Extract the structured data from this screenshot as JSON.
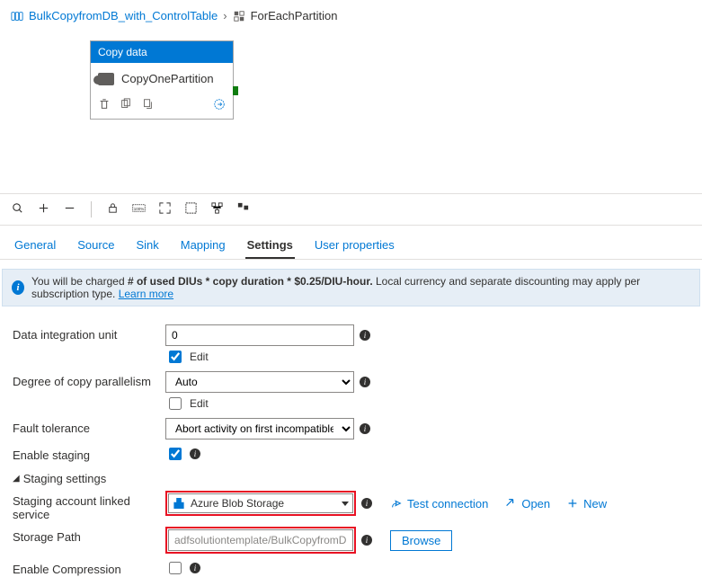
{
  "breadcrumb": {
    "parent": "BulkCopyfromDB_with_ControlTable",
    "current": "ForEachPartition"
  },
  "activity": {
    "type_label": "Copy data",
    "name": "CopyOnePartition"
  },
  "tabs": {
    "general": "General",
    "source": "Source",
    "sink": "Sink",
    "mapping": "Mapping",
    "settings": "Settings",
    "user_props": "User properties"
  },
  "banner": {
    "prefix": "You will be charged ",
    "bold": "# of used DIUs * copy duration * $0.25/DIU-hour.",
    "suffix": " Local currency and separate discounting may apply per subscription type. ",
    "link": "Learn more"
  },
  "settings": {
    "diu": {
      "label": "Data integration unit",
      "value": "0",
      "edit": "Edit",
      "edit_checked": true
    },
    "parallelism": {
      "label": "Degree of copy parallelism",
      "value": "Auto",
      "edit": "Edit",
      "edit_checked": false
    },
    "fault": {
      "label": "Fault tolerance",
      "value": "Abort activity on first incompatible row"
    },
    "staging": {
      "label": "Enable staging",
      "checked": true
    },
    "staging_section": "Staging settings",
    "linked_service": {
      "label": "Staging account linked service",
      "value": "Azure Blob Storage"
    },
    "storage_path": {
      "label": "Storage Path",
      "value": "adfsolutiontemplate/BulkCopyfromDB_with_ControlTable",
      "browse": "Browse"
    },
    "compression": {
      "label": "Enable Compression",
      "checked": false
    },
    "actions": {
      "test": "Test connection",
      "open": "Open",
      "new": "New"
    }
  }
}
